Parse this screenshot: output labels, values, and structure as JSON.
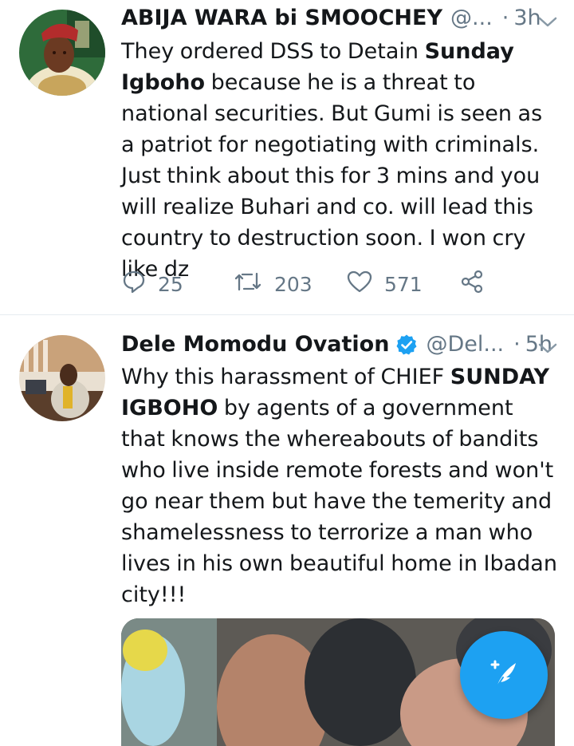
{
  "tweets": [
    {
      "display_name": "ABIJA WARA bi SMOOCHEY",
      "handle": "@...",
      "separator": "·",
      "time": "3h",
      "verified": false,
      "text_segments": [
        {
          "text": "They ordered DSS to Detain ",
          "bold": false
        },
        {
          "text": "Sunday Igboho",
          "bold": true
        },
        {
          "text": " because he is a threat to national securities. But Gumi is seen as a patriot for negotiating with criminals. Just think about this for 3 mins and you will realize Buhari and co. will lead this country to destruction soon. I won cry like dz",
          "bold": false
        }
      ],
      "replies": "25",
      "retweets": "203",
      "likes": "571"
    },
    {
      "display_name": "Dele Momodu Ovation",
      "handle": "@Del...",
      "separator": "·",
      "time": "5h",
      "verified": true,
      "text_segments": [
        {
          "text": "Why this harassment of CHIEF ",
          "bold": false
        },
        {
          "text": "SUNDAY IGBOHO",
          "bold": true
        },
        {
          "text": " by agents of a government that knows the whereabouts of bandits who live inside remote forests and won't go near them but have the temerity and shamelessness  to terrorize a man who lives in his own beautiful home in Ibadan city!!!",
          "bold": false
        }
      ],
      "has_media": true
    }
  ],
  "colors": {
    "accent": "#1da1f2",
    "text": "#14171a",
    "secondary": "#657786",
    "divider": "#e6ecf0"
  },
  "icons": {
    "reply": "reply-icon",
    "retweet": "retweet-icon",
    "like": "heart-icon",
    "share": "share-icon",
    "verified": "verified-badge-icon",
    "more": "chevron-down-icon",
    "compose": "compose-tweet-icon"
  }
}
